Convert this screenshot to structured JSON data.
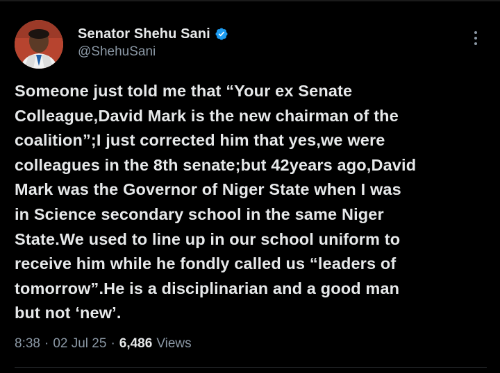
{
  "author": {
    "display_name": "Senator Shehu Sani",
    "handle": "@ShehuSani",
    "verified_icon": "verified-badge-icon"
  },
  "post": {
    "text": "Someone just told me that “Your ex Senate\nColleague,David Mark is the new chairman of the\ncoalition”;I just corrected him that yes,we were\ncolleagues in the 8th senate;but 42years ago,David\nMark was the Governor of Niger State when I was\nin Science secondary school in the same Niger\nState.We used to line up in our school uniform to\nreceive him while he fondly called us “leaders of\ntomorrow”.He is a disciplinarian and a good man\nbut not ‘new’."
  },
  "meta": {
    "time": "8:38",
    "separator": "·",
    "date": "02 Jul 25",
    "views_count": "6,486",
    "views_label": "Views"
  },
  "colors": {
    "background": "#000000",
    "text_primary": "#e7e9ea",
    "text_secondary": "#8b98a5",
    "verified_blue": "#1d9bf0"
  }
}
